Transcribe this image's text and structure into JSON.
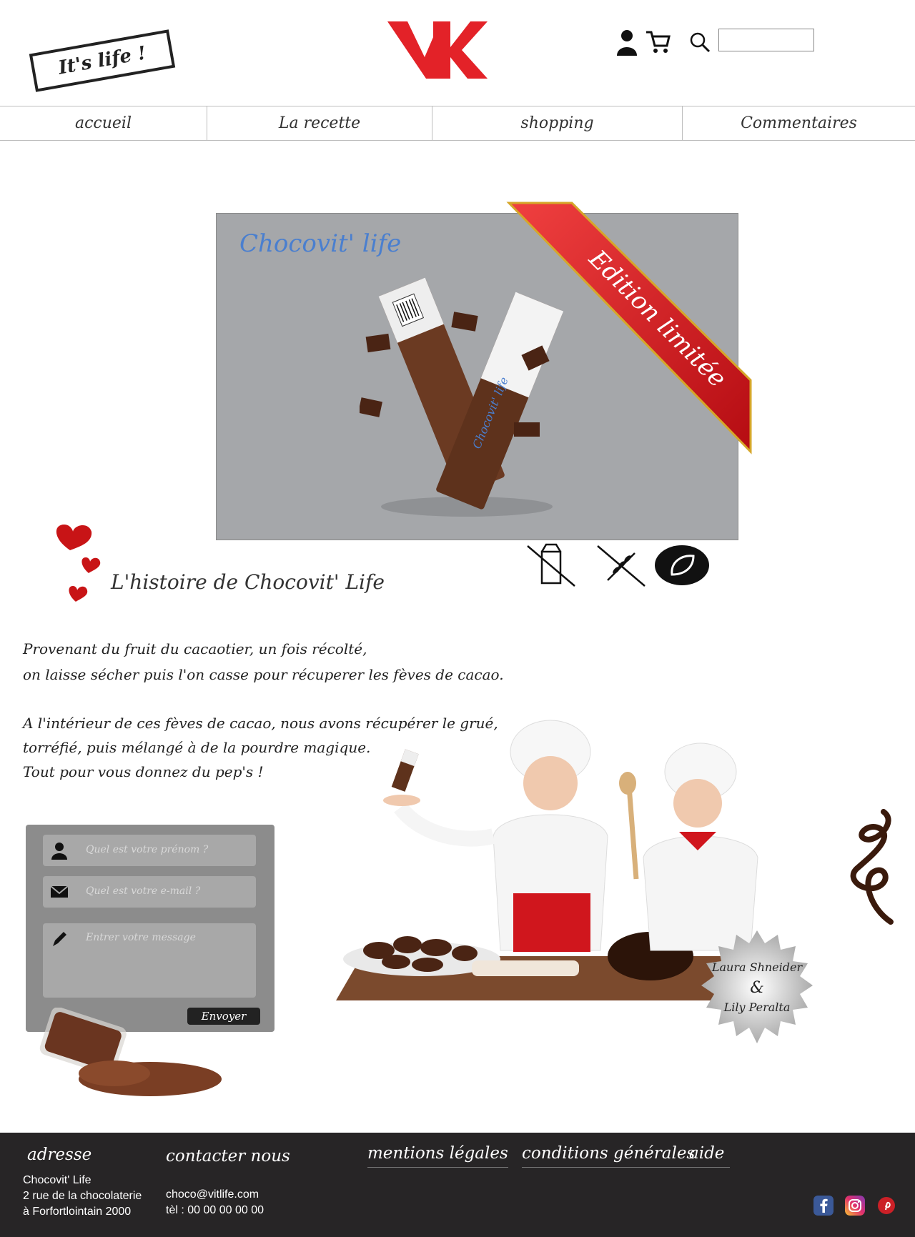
{
  "header": {
    "stamp_logo": "It's life !",
    "brand_logo_icon": "vk-logo",
    "user_icon": "user-icon",
    "cart_icon": "cart-icon",
    "search_icon": "search-icon",
    "search_value": ""
  },
  "nav": {
    "items": [
      {
        "label": "accueil"
      },
      {
        "label": "La recette"
      },
      {
        "label": "shopping"
      },
      {
        "label": "Commentaires"
      }
    ]
  },
  "hero": {
    "title": "Chocovit' life",
    "ribbon_text": "Edition limitée",
    "bar_brand": "Chocovit' life"
  },
  "badges": [
    "no-milk-icon",
    "gluten-free-icon",
    "vegan-leaf-icon"
  ],
  "story": {
    "title": "L'histoire de Chocovit' Life",
    "lines": [
      "Provenant du fruit du cacaotier, un fois récolté,",
      "on laisse sécher puis l'on casse pour récuperer les fèves de cacao.",
      "A l'intérieur de ces fèves de cacao, nous avons récupérer le grué,",
      " torréfié, puis mélangé à de la pourdre magique.",
      "  Tout pour vous donnez du pep's !"
    ]
  },
  "form": {
    "name_placeholder": "Quel est votre prénom ?",
    "email_placeholder": "Quel est votre e-mail ?",
    "message_placeholder": "Entrer votre message",
    "send_label": "Envoyer"
  },
  "chefs": {
    "name1": "Laura Shneider",
    "amp": "&",
    "name2": "Lily Peralta"
  },
  "footer": {
    "address_title": "adresse",
    "address_lines": [
      "Chocovit' Life",
      "2 rue de la chocolaterie",
      "à Forfortlointain 2000"
    ],
    "contact_title": "contacter nous",
    "contact_lines": [
      "choco@vitlife.com",
      "tèl : 00 00 00 00 00"
    ],
    "legal_title": "mentions légales",
    "terms_title": "conditions générales",
    "help_title": "aide",
    "social": [
      "facebook-icon",
      "instagram-icon",
      "pinterest-icon"
    ]
  },
  "colors": {
    "accent_red": "#e32228",
    "hero_bg": "#a5a7aa",
    "footer_bg": "#272526",
    "brand_blue": "#4a7fcf"
  }
}
